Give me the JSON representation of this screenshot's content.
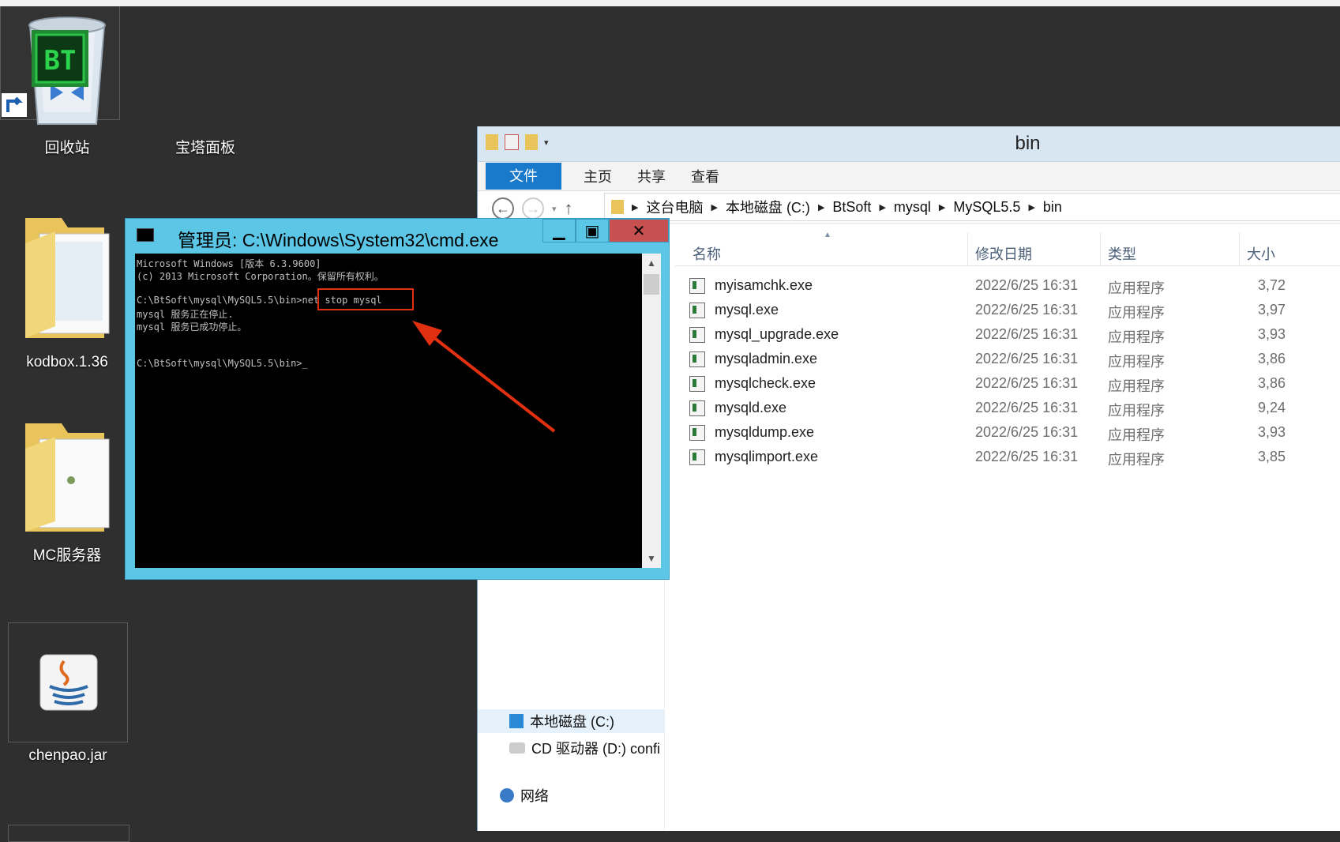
{
  "desktop": {
    "icons": [
      {
        "label": "回收站"
      },
      {
        "label": "宝塔面板",
        "logo_text": "BT"
      },
      {
        "label": "kodbox.1.36"
      },
      {
        "label": "MC服务器"
      },
      {
        "label": "chenpao.jar"
      }
    ]
  },
  "explorer": {
    "title": "bin",
    "ribbon": {
      "file": "文件",
      "home": "主页",
      "share": "共享",
      "view": "查看"
    },
    "breadcrumbs": [
      "这台电脑",
      "本地磁盘 (C:)",
      "BtSoft",
      "mysql",
      "MySQL5.5",
      "bin"
    ],
    "columns": {
      "name": "名称",
      "date": "修改日期",
      "type": "类型",
      "size": "大小"
    },
    "files": [
      {
        "name": "myisamchk.exe",
        "date": "2022/6/25 16:31",
        "type": "应用程序",
        "size": "3,72"
      },
      {
        "name": "mysql.exe",
        "date": "2022/6/25 16:31",
        "type": "应用程序",
        "size": "3,97"
      },
      {
        "name": "mysql_upgrade.exe",
        "date": "2022/6/25 16:31",
        "type": "应用程序",
        "size": "3,93"
      },
      {
        "name": "mysqladmin.exe",
        "date": "2022/6/25 16:31",
        "type": "应用程序",
        "size": "3,86"
      },
      {
        "name": "mysqlcheck.exe",
        "date": "2022/6/25 16:31",
        "type": "应用程序",
        "size": "3,86"
      },
      {
        "name": "mysqld.exe",
        "date": "2022/6/25 16:31",
        "type": "应用程序",
        "size": "9,24"
      },
      {
        "name": "mysqldump.exe",
        "date": "2022/6/25 16:31",
        "type": "应用程序",
        "size": "3,93"
      },
      {
        "name": "mysqlimport.exe",
        "date": "2022/6/25 16:31",
        "type": "应用程序",
        "size": "3,85"
      }
    ],
    "nav": {
      "local_disk": "本地磁盘 (C:)",
      "cd_drive": "CD 驱动器 (D:) confi",
      "network": "网络"
    }
  },
  "cmd": {
    "title": "管理员: C:\\Windows\\System32\\cmd.exe",
    "lines": [
      "Microsoft Windows [版本 6.3.9600]",
      "(c) 2013 Microsoft Corporation。保留所有权利。",
      "",
      "C:\\BtSoft\\mysql\\MySQL5.5\\bin>net stop mysql",
      "mysql 服务正在停止.",
      "mysql 服务已成功停止。",
      "",
      "",
      "C:\\BtSoft\\mysql\\MySQL5.5\\bin>_"
    ]
  },
  "colors": {
    "cmd_frame": "#5cc6e6",
    "file_tab": "#1979ca",
    "annotation": "#e03010",
    "close_button": "#c75050"
  }
}
